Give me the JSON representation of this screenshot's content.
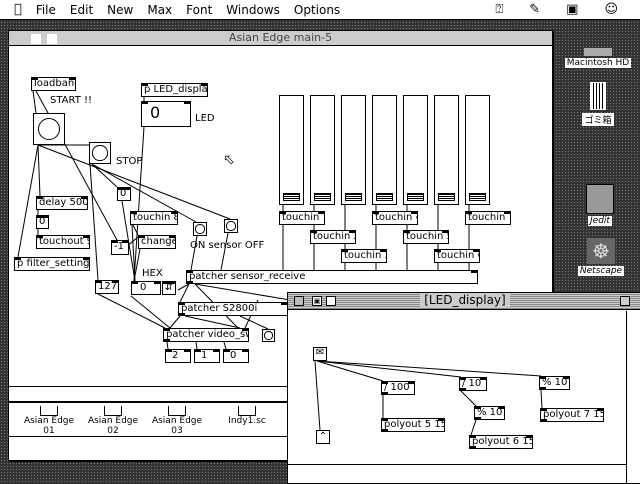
{
  "menubar": {
    "items": [
      "File",
      "Edit",
      "New",
      "Max",
      "Font",
      "Windows",
      "Options"
    ],
    "icons": [
      "apple-icon",
      "help-icon",
      "pencil-icon",
      "application-icon",
      "user-icon"
    ]
  },
  "main_window": {
    "title": "Asian Edge main-5",
    "objects": {
      "loadbang": "loadbang",
      "start_label": "START !!",
      "p_led": "p LED_display",
      "led_value": "0",
      "led_label": "LED",
      "stop_label": "STOP",
      "msg0": "0",
      "delay": "delay 500",
      "box0": "0",
      "touchout": "touchout 9",
      "filter": "p filter_setting",
      "touchin8": "touchin 8",
      "minus1": "-1",
      "change": "change",
      "sensor_label": "ON sensor OFF",
      "hex_label": "HEX",
      "n127": "127",
      "hex_value": "0",
      "sensor_receive": "patcher sensor_receive",
      "s2800": "patcher S2800i",
      "video_sw": "patcher video_sw",
      "out2": "2",
      "out1": "1",
      "out0": "0"
    },
    "touchins": [
      "touchin 1",
      "touchin 2",
      "touchin 3",
      "touchin 4",
      "touchin 5",
      "touchin 6",
      "touchin 7"
    ]
  },
  "finder_window": {
    "files": [
      "Asian Edge 01",
      "Asian Edge 02",
      "Asian Edge 03",
      "Indy1.sc"
    ]
  },
  "led_window": {
    "title": "[LED_display]",
    "objects": {
      "div100": "/ 100",
      "div10": "/ 10",
      "mod10a": "% 10",
      "mod10b": "% 10",
      "poly5": "polyout 5 15",
      "poly6": "polyout 6 15",
      "poly7": "polyout 7 15"
    }
  },
  "desktop": {
    "icons": [
      "Macintosh HD",
      "ゴミ箱",
      "Jedit",
      "Netscape"
    ]
  }
}
